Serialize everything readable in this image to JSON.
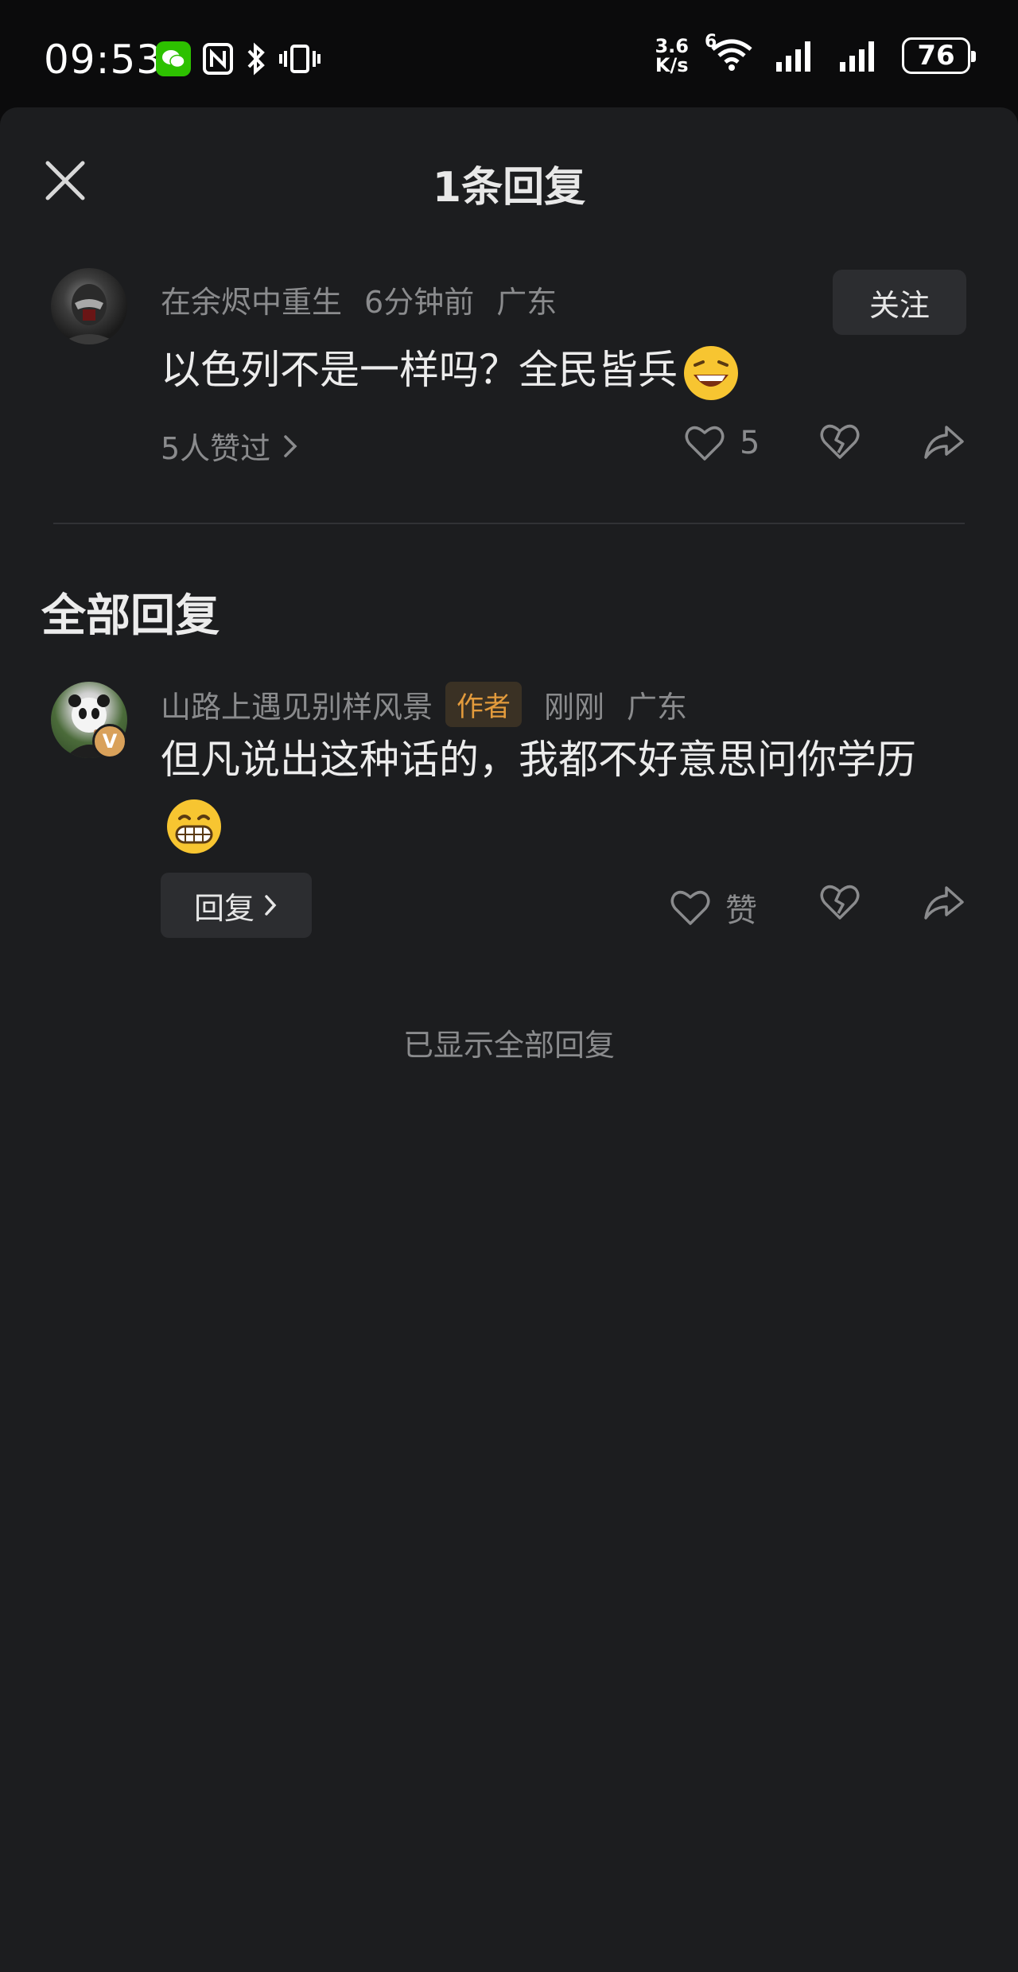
{
  "status_bar": {
    "time": "09:53",
    "net_speed_value": "3.6",
    "net_speed_unit": "K/s",
    "signal_label": "6",
    "battery": "76"
  },
  "sheet": {
    "title": "1条回复"
  },
  "main_comment": {
    "username": "在余烬中重生",
    "time": "6分钟前",
    "location": "广东",
    "follow_label": "关注",
    "text": "以色列不是一样吗？全民皆兵",
    "emoji": "laughing-emoji",
    "likes_link": "5人赞过",
    "like_count": "5"
  },
  "section_title": "全部回复",
  "reply": {
    "username": "山路上遇见别样风景",
    "author_tag": "作者",
    "time": "刚刚",
    "location": "广东",
    "text": "但凡说出这种话的，我都不好意思问你学历",
    "emoji": "grinning-emoji",
    "reply_label": "回复",
    "like_label": "赞",
    "badge": "V"
  },
  "end_note": "已显示全部回复",
  "colors": {
    "background": "#1c1d1f",
    "author_tag": "#e39b3c",
    "wechat": "#2dc100"
  }
}
